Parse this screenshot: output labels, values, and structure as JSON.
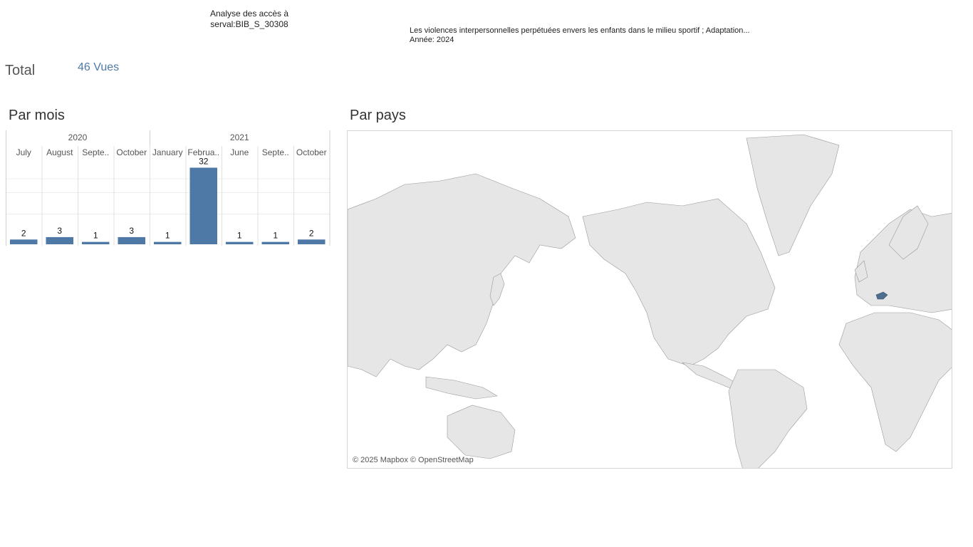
{
  "header": {
    "title_line1": "Analyse des accès à",
    "title_line2": "serval:BIB_S_30308",
    "doc_title": "Les violences interpersonnelles perpétuées envers les enfants dans le milieu sportif ; Adaptation...",
    "doc_year": "Année: 2024"
  },
  "total": {
    "label": "Total",
    "value": "46 Vues"
  },
  "sections": {
    "by_month": "Par mois",
    "by_country": "Par pays"
  },
  "chart_data": {
    "type": "bar",
    "years": [
      {
        "label": "2020",
        "months": 4
      },
      {
        "label": "2021",
        "months": 5
      }
    ],
    "categories": [
      "July",
      "August",
      "Septe..",
      "October",
      "January",
      "Februa..",
      "June",
      "Septe..",
      "October"
    ],
    "values": [
      2,
      3,
      1,
      3,
      1,
      32,
      1,
      1,
      2
    ],
    "ylim": [
      0,
      36
    ],
    "grid": true,
    "bar_color": "#4e79a7"
  },
  "map": {
    "attribution": "© 2025 Mapbox © OpenStreetMap",
    "highlighted_country": "Switzerland",
    "highlight_color": "#4e6e8e",
    "land_color": "#e6e6e6",
    "border_color": "#9a9a9a"
  }
}
